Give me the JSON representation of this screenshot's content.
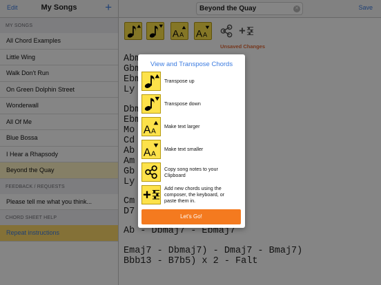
{
  "sidebar": {
    "edit_label": "Edit",
    "title": "My Songs",
    "add_label": "+",
    "section_songs": "My Songs",
    "items": [
      {
        "label": "All Chord Examples"
      },
      {
        "label": "Little Wing"
      },
      {
        "label": "Walk Don't Run"
      },
      {
        "label": "On Green Dolphin Street"
      },
      {
        "label": "Wonderwall"
      },
      {
        "label": "All Of Me"
      },
      {
        "label": "Blue Bossa"
      },
      {
        "label": "I Hear a Rhapsody"
      },
      {
        "label": "Beyond the Quay"
      }
    ],
    "section_feedback": "Feedback / Requests",
    "feedback_item": "Please tell me what you think...",
    "section_help": "Chord Sheet Help",
    "help_item": "Repeat instructions"
  },
  "header": {
    "song_title": "Beyond the Quay",
    "save_label": "Save"
  },
  "toolbar": {
    "unsaved": "Unsaved Changes"
  },
  "editor": {
    "lines": [
      "Abm7",
      "Gbmaj7",
      "Ebm7     - Fm7)",
      "Ly",
      "",
      "Dbmaj7 - Abmaj7",
      "Ebmaj7",
      "Mo",
      "Cd",
      "Ab",
      "Am",
      "Gb",
      "Ly",
      "",
      "Cm",
      "D7",
      "",
      "Ab - Dbmaj7 - Ebmaj7",
      "",
      "Emaj7 - Dbmaj7) - Dmaj7 - Bmaj7)",
      "Bbb13 - B7b5) x 2 - Falt"
    ]
  },
  "modal": {
    "title": "View and Transpose Chords",
    "items": [
      {
        "icon": "transpose-up-icon",
        "text": "Transpose up"
      },
      {
        "icon": "transpose-down-icon",
        "text": "Transpose down"
      },
      {
        "icon": "text-larger-icon",
        "text": "Make text larger"
      },
      {
        "icon": "text-smaller-icon",
        "text": "Make text smaller"
      },
      {
        "icon": "share-icon",
        "text": "Copy song notes to your Clipboard"
      },
      {
        "icon": "add-chords-icon",
        "text": "Add new chords using the composer, the keyboard, or paste them in."
      }
    ],
    "button": "Let's Go!"
  },
  "colors": {
    "accent": "#3b7be0",
    "icon_yellow": "#fde24a",
    "button_orange": "#f47a1f",
    "unsaved_orange": "#e36b3a",
    "selected_row": "#fed96a"
  }
}
